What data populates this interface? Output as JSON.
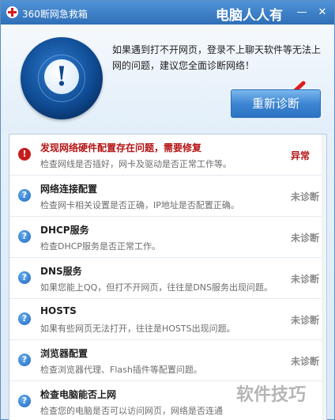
{
  "window": {
    "title": "360断网急救箱",
    "watermark": "电脑人人有"
  },
  "header": {
    "hint": "如果遇到打不开网页，登录不上聊天软件等无法上网的问题，建议您全面诊断网络！",
    "rediagnose_label": "重新诊断"
  },
  "items": [
    {
      "title": "发现网络硬件配置存在问题，需要修复",
      "desc": "检查网线是否插好，网卡及驱动是否正常工作等。",
      "status": "异常",
      "state": "error"
    },
    {
      "title": "网络连接配置",
      "desc": "检查网卡相关设置是否正确，IP地址是否配置正确。",
      "status": "未诊断",
      "state": "pending"
    },
    {
      "title": "DHCP服务",
      "desc": "检查DHCP服务是否正常工作。",
      "status": "未诊断",
      "state": "pending"
    },
    {
      "title": "DNS服务",
      "desc": "如果您能上QQ，但打不开网页，往往是DNS服务出现问题。",
      "status": "未诊断",
      "state": "pending"
    },
    {
      "title": "HOSTS",
      "desc": "如果有些网页无法打开，往往是HOSTS出现问题。",
      "status": "未诊断",
      "state": "pending"
    },
    {
      "title": "浏览器配置",
      "desc": "检查浏览器代理、Flash插件等配置问题。",
      "status": "未诊断",
      "state": "pending"
    },
    {
      "title": "检查电脑能否上网",
      "desc": "检查您的电脑是否可以访问网页，网络是否连通",
      "status": "",
      "state": "pending"
    }
  ],
  "overlay_watermark": "软件技巧",
  "colors": {
    "accent": "#2f6fb7",
    "alert": "#b51515"
  }
}
